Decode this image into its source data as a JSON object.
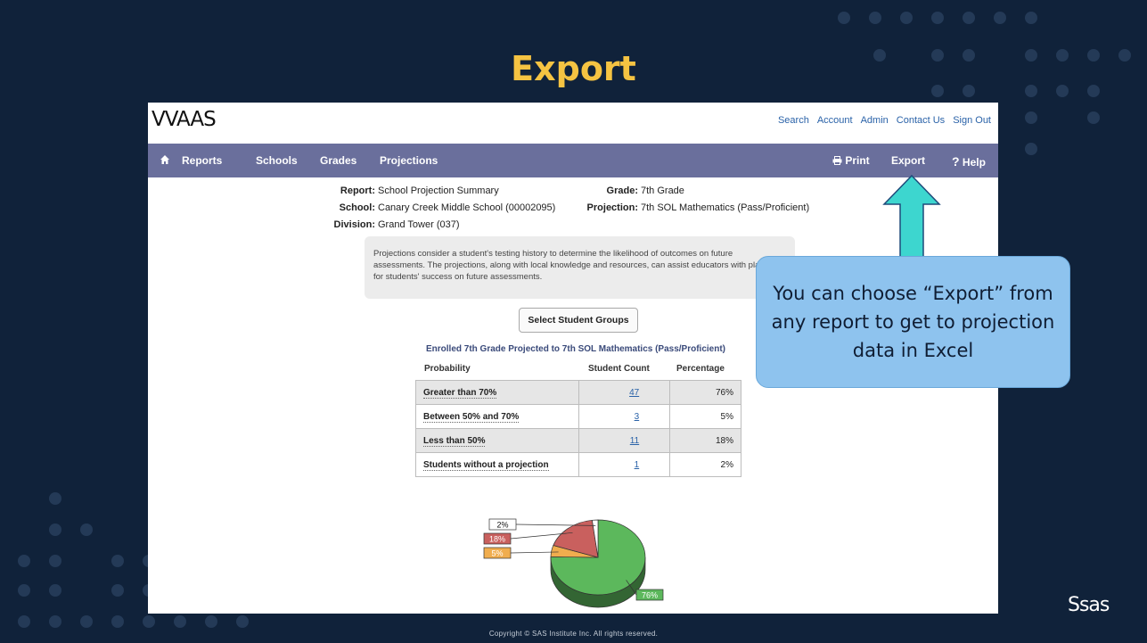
{
  "slide": {
    "title": "Export",
    "copyright": "Copyright © SAS Institute Inc. All rights reserved.",
    "brand_logo": "Ssas"
  },
  "app": {
    "logo": "VVAAS",
    "top_links": [
      "Search",
      "Account",
      "Admin",
      "Contact Us",
      "Sign Out"
    ],
    "nav": {
      "home_icon": "home-icon",
      "items": [
        "Reports",
        "Schools",
        "Grades",
        "Projections"
      ],
      "print_label": "Print",
      "print_icon": "printer-icon",
      "export_label": "Export",
      "help_label": "Help",
      "help_icon": "?"
    },
    "report": {
      "report_label": "Report:",
      "report_value": "School Projection Summary",
      "school_label": "School:",
      "school_value": "Canary Creek Middle School (00002095)",
      "division_label": "Division:",
      "division_value": "Grand Tower (037)",
      "grade_label": "Grade:",
      "grade_value": "7th Grade",
      "projection_label": "Projection:",
      "projection_value": "7th SOL Mathematics (Pass/Proficient)"
    },
    "info_text": "Projections consider a student's testing history to determine the likelihood of outcomes on future assessments. The projections, along with local knowledge and resources, can assist educators with planning for students' success on future assessments.",
    "select_groups_label": "Select Student Groups",
    "table": {
      "title": "Enrolled 7th Grade Projected to 7th SOL Mathematics (Pass/Proficient)",
      "headers": [
        "Probability",
        "Student Count",
        "Percentage"
      ],
      "rows": [
        {
          "category": "Greater than 70%",
          "count": "47",
          "percentage": "76%"
        },
        {
          "category": "Between 50% and 70%",
          "count": "3",
          "percentage": "5%"
        },
        {
          "category": "Less than 50%",
          "count": "11",
          "percentage": "18%"
        },
        {
          "category": "Students without a projection",
          "count": "1",
          "percentage": "2%"
        }
      ]
    }
  },
  "chart_data": {
    "type": "pie",
    "slices": [
      {
        "label": "76%",
        "value": 76,
        "color": "#5cb85c"
      },
      {
        "label": "5%",
        "value": 5,
        "color": "#f0ad4e"
      },
      {
        "label": "18%",
        "value": 18,
        "color": "#c9605e"
      },
      {
        "label": "2%",
        "value": 2,
        "color": "#ffffff"
      }
    ]
  },
  "callout": {
    "text": "You can choose “Export” from any report to get to projection data in Excel",
    "color": "#8ec3ee",
    "arrow_color": "#3dd6cf"
  }
}
